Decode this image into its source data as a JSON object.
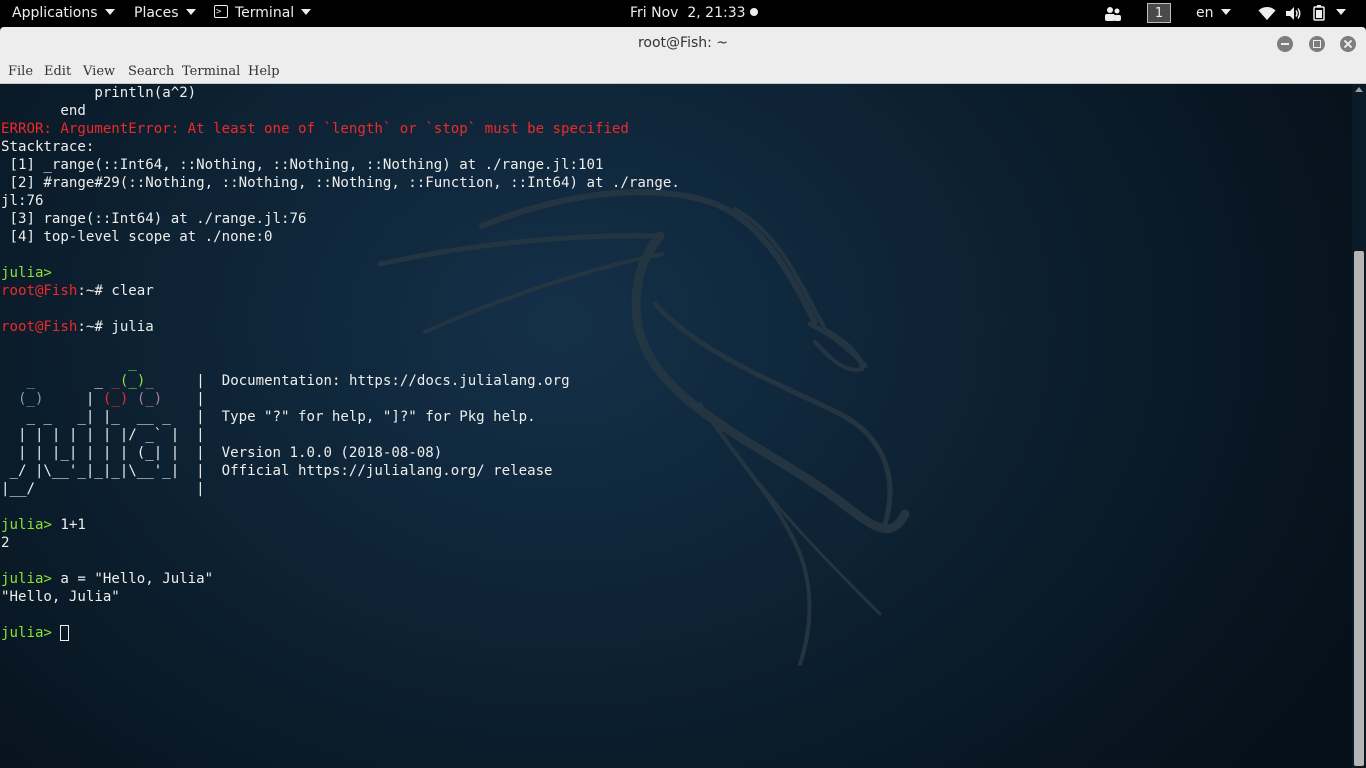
{
  "top_panel": {
    "applications_label": "Applications",
    "places_label": "Places",
    "terminal_label": "Terminal",
    "clock": "Fri Nov  2, 21:33",
    "workspace": "1",
    "language": "en"
  },
  "window": {
    "title": "root@Fish: ~"
  },
  "menu": {
    "file": "File",
    "edit": "Edit",
    "view": "View",
    "search": "Search",
    "terminal": "Terminal",
    "help": "Help"
  },
  "terminal": {
    "l1": "           println(a^2)",
    "l2": "       end",
    "l3": "ERROR: ArgumentError: At least one of `length` or `stop` must be specified",
    "l4": "Stacktrace:",
    "l5": " [1] _range(::Int64, ::Nothing, ::Nothing, ::Nothing) at ./range.jl:101",
    "l6": " [2] #range#29(::Nothing, ::Nothing, ::Nothing, ::Function, ::Int64) at ./range.",
    "l7": "jl:76",
    "l8": " [3] range(::Int64) at ./range.jl:76",
    "l9": " [4] top-level scope at ./none:0",
    "julia_prompt": "julia>",
    "root_prompt_user": "root@Fish",
    "root_prompt_rest": ":~# ",
    "cmd_clear": "clear",
    "cmd_julia": "julia",
    "banner": {
      "doc": "Documentation: https://docs.julialang.org",
      "help": "Type \"?\" for help, \"]?\" for Pkg help.",
      "version": "Version 1.0.0 (2018-08-08)",
      "release": "Official https://julialang.org/ release"
    },
    "in1": " 1+1",
    "out1": "2",
    "in2": " a = \"Hello, Julia\"",
    "out2": "\"Hello, Julia\""
  }
}
